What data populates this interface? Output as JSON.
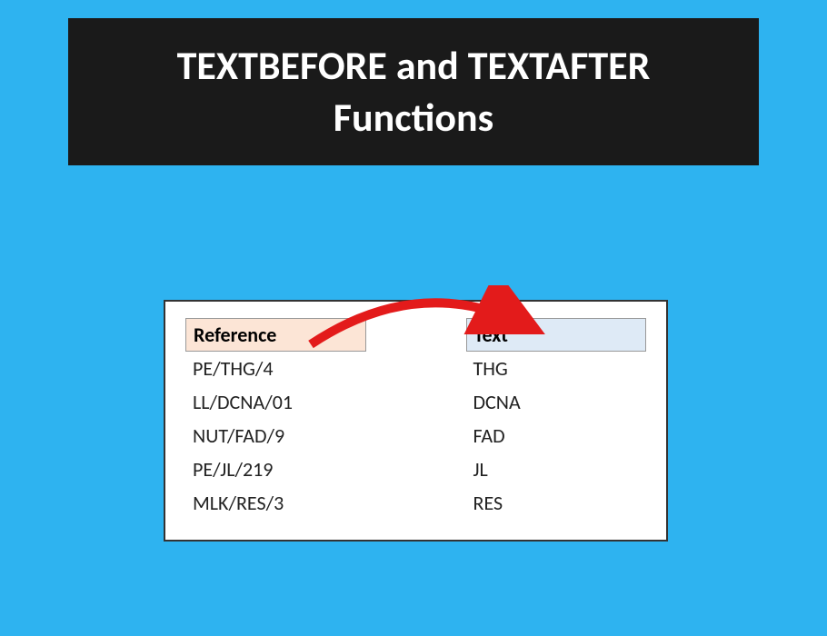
{
  "title": "TEXTBEFORE and TEXTAFTER Functions",
  "table": {
    "headers": {
      "reference": "Reference",
      "text": "Text"
    },
    "rows": [
      {
        "reference": "PE/THG/4",
        "text": "THG"
      },
      {
        "reference": "LL/DCNA/01",
        "text": "DCNA"
      },
      {
        "reference": "NUT/FAD/9",
        "text": "FAD"
      },
      {
        "reference": "PE/JL/219",
        "text": "JL"
      },
      {
        "reference": "MLK/RES/3",
        "text": "RES"
      }
    ]
  },
  "colors": {
    "background": "#2eb3f0",
    "banner": "#1a1a1a",
    "arrow": "#e31b1b",
    "header_reference": "#fce5d6",
    "header_text": "#deeaf6"
  }
}
